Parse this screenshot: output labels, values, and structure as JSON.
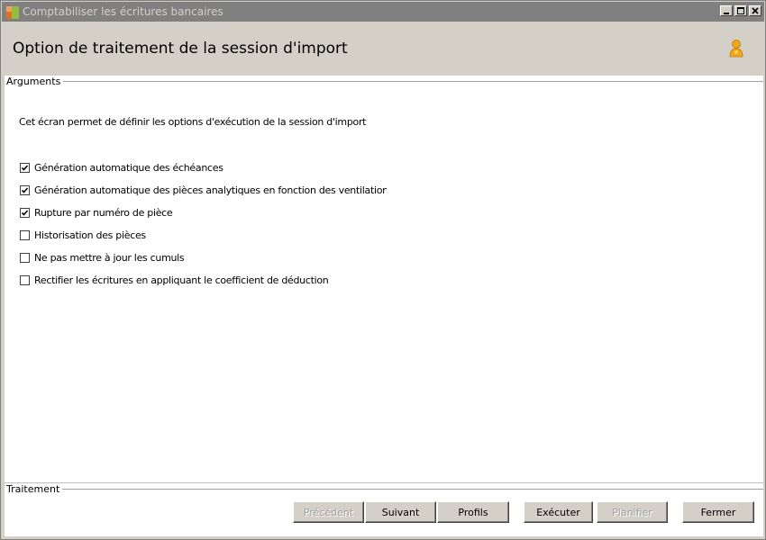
{
  "window": {
    "title": "Comptabiliser les écritures bancaires"
  },
  "header": {
    "title": "Option de traitement de la session d'import"
  },
  "arguments": {
    "legend": "Arguments",
    "description": "Cet écran permet de définir les options  d'exécution de la session  d'import",
    "options": [
      {
        "label": "Génération automatique des échéances",
        "checked": true
      },
      {
        "label": "Génération automatique des pièces analytiques en fonction des ventilation modèles",
        "checked": true
      },
      {
        "label": "Rupture par numéro de pièce",
        "checked": true
      },
      {
        "label": "Historisation des pièces",
        "checked": false
      },
      {
        "label": "Ne pas mettre à jour les cumuls",
        "checked": false
      },
      {
        "label": "Rectifier les écritures en appliquant le coefficient de déduction",
        "checked": false
      }
    ]
  },
  "traitement": {
    "legend": "Traitement"
  },
  "buttons": {
    "precedent": "Précédent",
    "suivant": "Suivant",
    "profils": "Profils",
    "executer": "Exécuter",
    "planifier": "Planifier",
    "fermer": "Fermer"
  }
}
